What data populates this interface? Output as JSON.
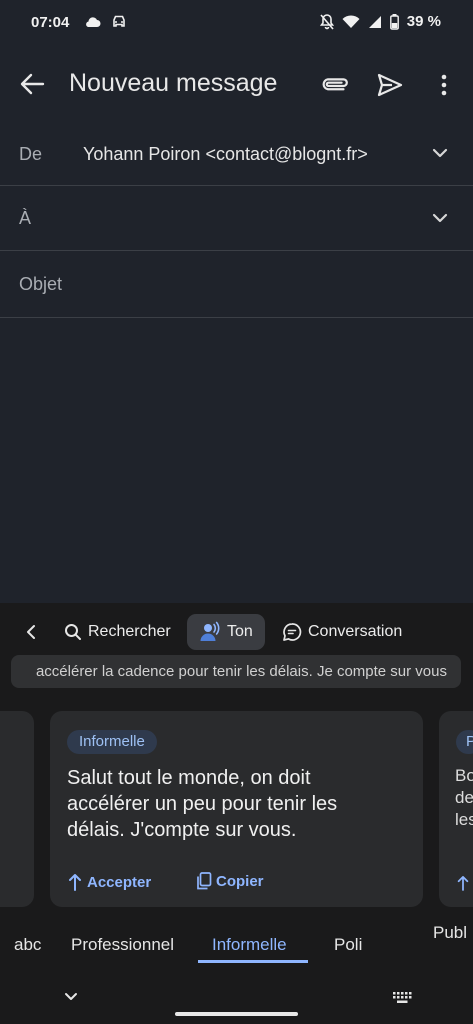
{
  "status_bar": {
    "time": "07:04",
    "battery": "39 %",
    "icons": [
      "cloud-icon",
      "car-icon",
      "notifications-off-icon",
      "wifi-icon",
      "signal-icon",
      "battery-icon"
    ]
  },
  "app_bar": {
    "title": "Nouveau message",
    "icons": [
      "back-arrow-icon",
      "paperclip-icon",
      "send-icon",
      "more-vert-icon"
    ]
  },
  "compose": {
    "from_label": "De",
    "from_value": "Yohann Poiron  <contact@blognt.fr>",
    "to_label": "À",
    "subject_placeholder": "Objet"
  },
  "keyboard": {
    "tools": {
      "search": "Rechercher",
      "tone": "Ton",
      "conversation": "Conversation"
    },
    "preview_text": "accélérer la cadence pour tenir les délais. Je compte sur vous",
    "cards": [
      {
        "chip": "Informelle",
        "text": "Salut tout le monde, on doit accélérer un peu pour tenir les délais. J'compte sur vous.",
        "accept": "Accepter",
        "copy": "Copier"
      }
    ],
    "peek_card": {
      "chip": "P",
      "lines": [
        "Bo",
        "de",
        "les"
      ]
    },
    "tone_tabs": [
      "abc",
      "Professionnel",
      "Informelle",
      "Poli",
      "Publ"
    ],
    "active_tab": "Informelle"
  },
  "colors": {
    "background": "#1f232b",
    "accent": "#8fb6ff",
    "keyboard_bg": "#1a1a1b"
  }
}
